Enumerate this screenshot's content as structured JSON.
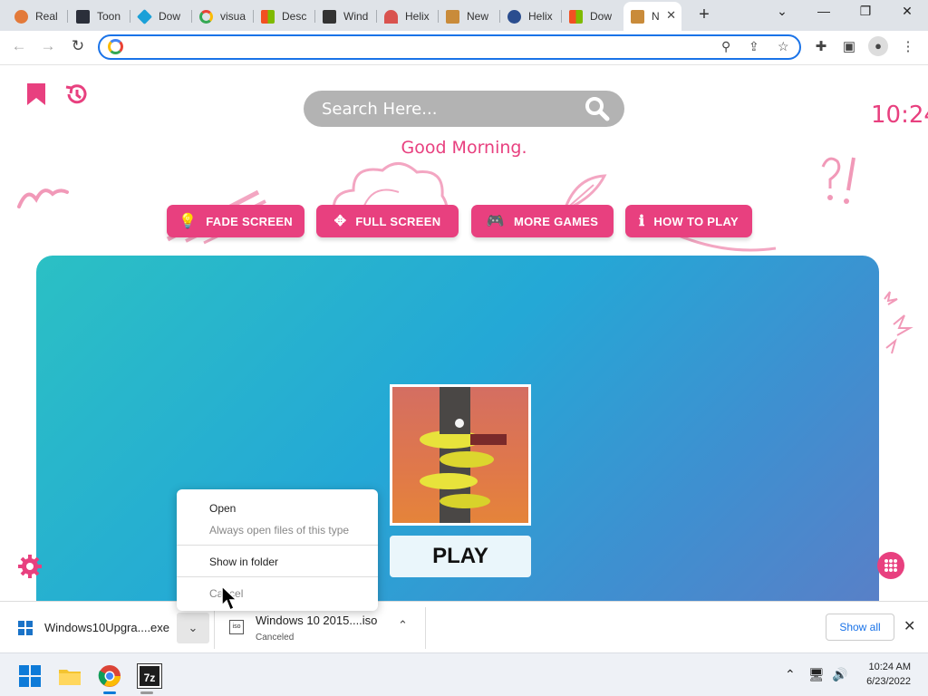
{
  "browser": {
    "tabs": [
      {
        "label": "Real",
        "color": "#e37a3a"
      },
      {
        "label": "Toon",
        "color": "#2b2f3a"
      },
      {
        "label": "Dow",
        "color": "#1ba0d8"
      },
      {
        "label": "visua",
        "color": "#34a853"
      },
      {
        "label": "Desc",
        "color": "#f25022"
      },
      {
        "label": "Wind",
        "color": "#333333"
      },
      {
        "label": "Helix",
        "color": "#d9534f"
      },
      {
        "label": "New",
        "color": "#c98b3a"
      },
      {
        "label": "Helix",
        "color": "#2a4d8f"
      },
      {
        "label": "Dow",
        "color": "#f25022"
      },
      {
        "label": "N",
        "color": "#c98b3a"
      }
    ],
    "address": "",
    "new_tab": "+"
  },
  "page": {
    "search_placeholder": "Search Here...",
    "greeting": "Good Morning.",
    "clock": "10:24",
    "buttons": {
      "fade": "FADE SCREEN",
      "full": "FULL SCREEN",
      "more": "MORE GAMES",
      "howto": "HOW TO PLAY"
    },
    "play": "PLAY",
    "accent": "#e8407f"
  },
  "context_menu": {
    "open": "Open",
    "always_open": "Always open files of this type",
    "show_in_folder": "Show in folder",
    "cancel": "Cancel"
  },
  "downloads": {
    "items": [
      {
        "name": "Windows10Upgra....exe",
        "status": ""
      },
      {
        "name": "Windows 10 2015....iso",
        "status": "Canceled"
      }
    ],
    "show_all": "Show all"
  },
  "taskbar": {
    "time": "10:24 AM",
    "date": "6/23/2022"
  }
}
